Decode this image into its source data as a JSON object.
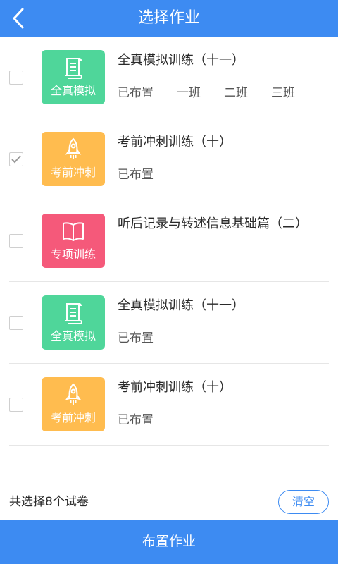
{
  "header": {
    "title": "选择作业",
    "back_icon": "chevron-left-icon"
  },
  "colors": {
    "primary": "#3d8bf2",
    "tile_green": "#4fd69a",
    "tile_orange": "#ffbc4f",
    "tile_pink": "#f5597a"
  },
  "items": [
    {
      "checked": false,
      "tile_label": "全真模拟",
      "tile_icon": "scroll-icon",
      "title": "全真模拟训练（十一）",
      "meta": [
        "已布置",
        "一班",
        "二班",
        "三班"
      ]
    },
    {
      "checked": true,
      "tile_label": "考前冲刺",
      "tile_icon": "rocket-icon",
      "title": "考前冲刺训练（十）",
      "meta": [
        "已布置"
      ]
    },
    {
      "checked": false,
      "tile_label": "专项训练",
      "tile_icon": "open-book-icon",
      "title": "听后记录与转述信息基础篇（二）",
      "meta": []
    },
    {
      "checked": false,
      "tile_label": "全真模拟",
      "tile_icon": "scroll-icon",
      "title": "全真模拟训练（十一）",
      "meta": [
        "已布置"
      ]
    },
    {
      "checked": false,
      "tile_label": "考前冲刺",
      "tile_icon": "rocket-icon",
      "title": "考前冲刺训练（十）",
      "meta": [
        "已布置"
      ]
    }
  ],
  "footer": {
    "count_text": "共选择8个试卷",
    "clear_label": "清空"
  },
  "submit_label": "布置作业"
}
